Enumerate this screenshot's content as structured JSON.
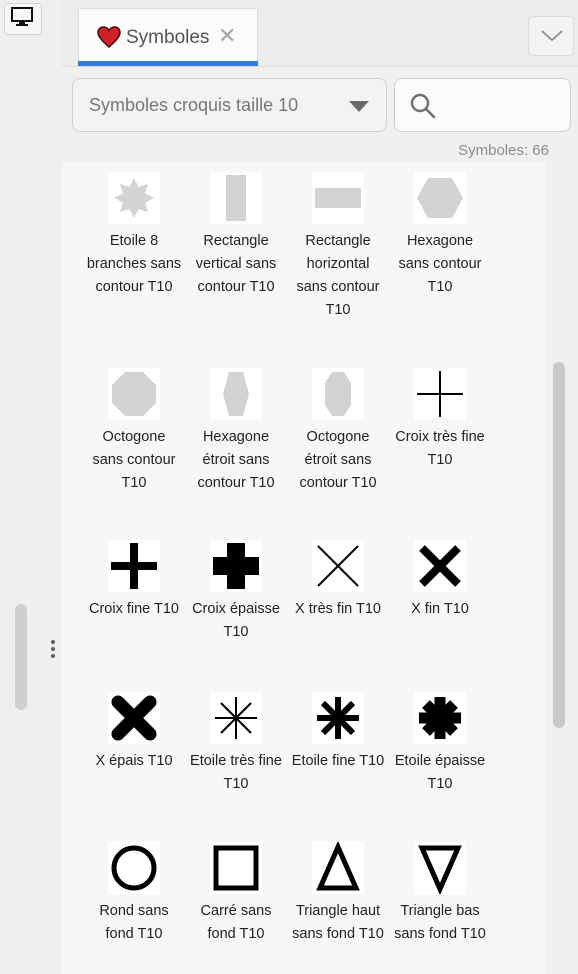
{
  "tab": {
    "title": "Symboles",
    "close": "✕"
  },
  "toolbar": {
    "library": "Symboles croquis taille 10",
    "search_value": "",
    "count_text": "Symboles: 66"
  },
  "symbols": [
    {
      "label": "Etoile 8 branches sans contour T10",
      "icon": "star8-filled-gray"
    },
    {
      "label": "Rectangle vertical sans contour T10",
      "icon": "rect-vertical-gray"
    },
    {
      "label": "Rectangle horizontal sans contour T10",
      "icon": "rect-horizontal-gray"
    },
    {
      "label": "Hexagone sans contour T10",
      "icon": "hexagon-gray"
    },
    {
      "label": "Octogone sans contour T10",
      "icon": "octagon-gray"
    },
    {
      "label": "Hexagone étroit sans contour T10",
      "icon": "hexagon-narrow-gray"
    },
    {
      "label": "Octogone étroit sans contour T10",
      "icon": "octagon-narrow-gray"
    },
    {
      "label": "Croix très fine T10",
      "icon": "cross-thin"
    },
    {
      "label": "Croix fine T10",
      "icon": "cross-medium"
    },
    {
      "label": "Croix épaisse T10",
      "icon": "cross-thick"
    },
    {
      "label": "X très fin T10",
      "icon": "x-thin"
    },
    {
      "label": "X fin T10",
      "icon": "x-medium"
    },
    {
      "label": "X épais T10",
      "icon": "x-thick"
    },
    {
      "label": "Etoile très fine T10",
      "icon": "asterisk-thin"
    },
    {
      "label": "Etoile fine T10",
      "icon": "asterisk-medium"
    },
    {
      "label": "Etoile épaisse T10",
      "icon": "asterisk-thick"
    },
    {
      "label": "Rond sans fond T10",
      "icon": "circle-outline"
    },
    {
      "label": "Carré sans fond T10",
      "icon": "square-outline"
    },
    {
      "label": "Triangle haut sans fond T10",
      "icon": "triangle-up-outline"
    },
    {
      "label": "Triangle bas sans fond T10",
      "icon": "triangle-down-outline"
    }
  ],
  "colors": {
    "accent": "#2f7ed8",
    "heart": "#d0202a",
    "symbol_gray": "#d3d3d3",
    "symbol_black": "#000000"
  }
}
